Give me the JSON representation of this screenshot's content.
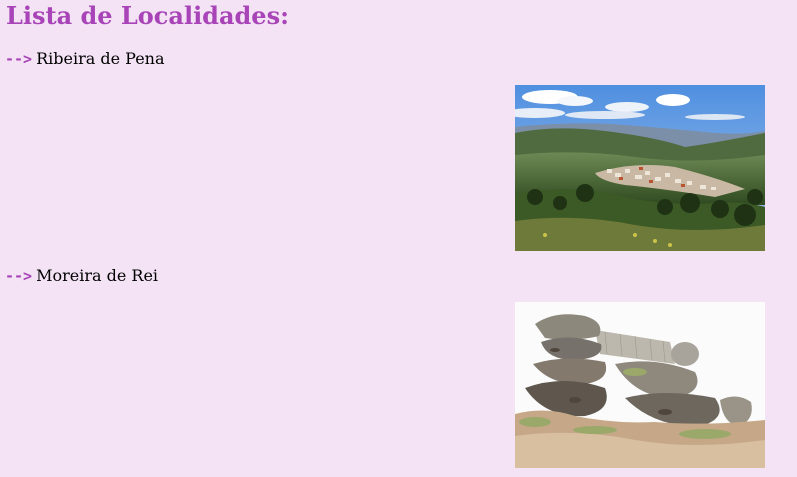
{
  "page": {
    "title": "Lista de Localidades:"
  },
  "localities": [
    {
      "arrow": "-->",
      "name": "Ribeira de Pena",
      "image": "landscape-photo"
    },
    {
      "arrow": "-->",
      "name": "Moreira de Rei",
      "image": "rock-formation-photo"
    }
  ],
  "colors": {
    "background": "#f3e3f5",
    "accent": "#a844b8",
    "text": "#000000"
  }
}
